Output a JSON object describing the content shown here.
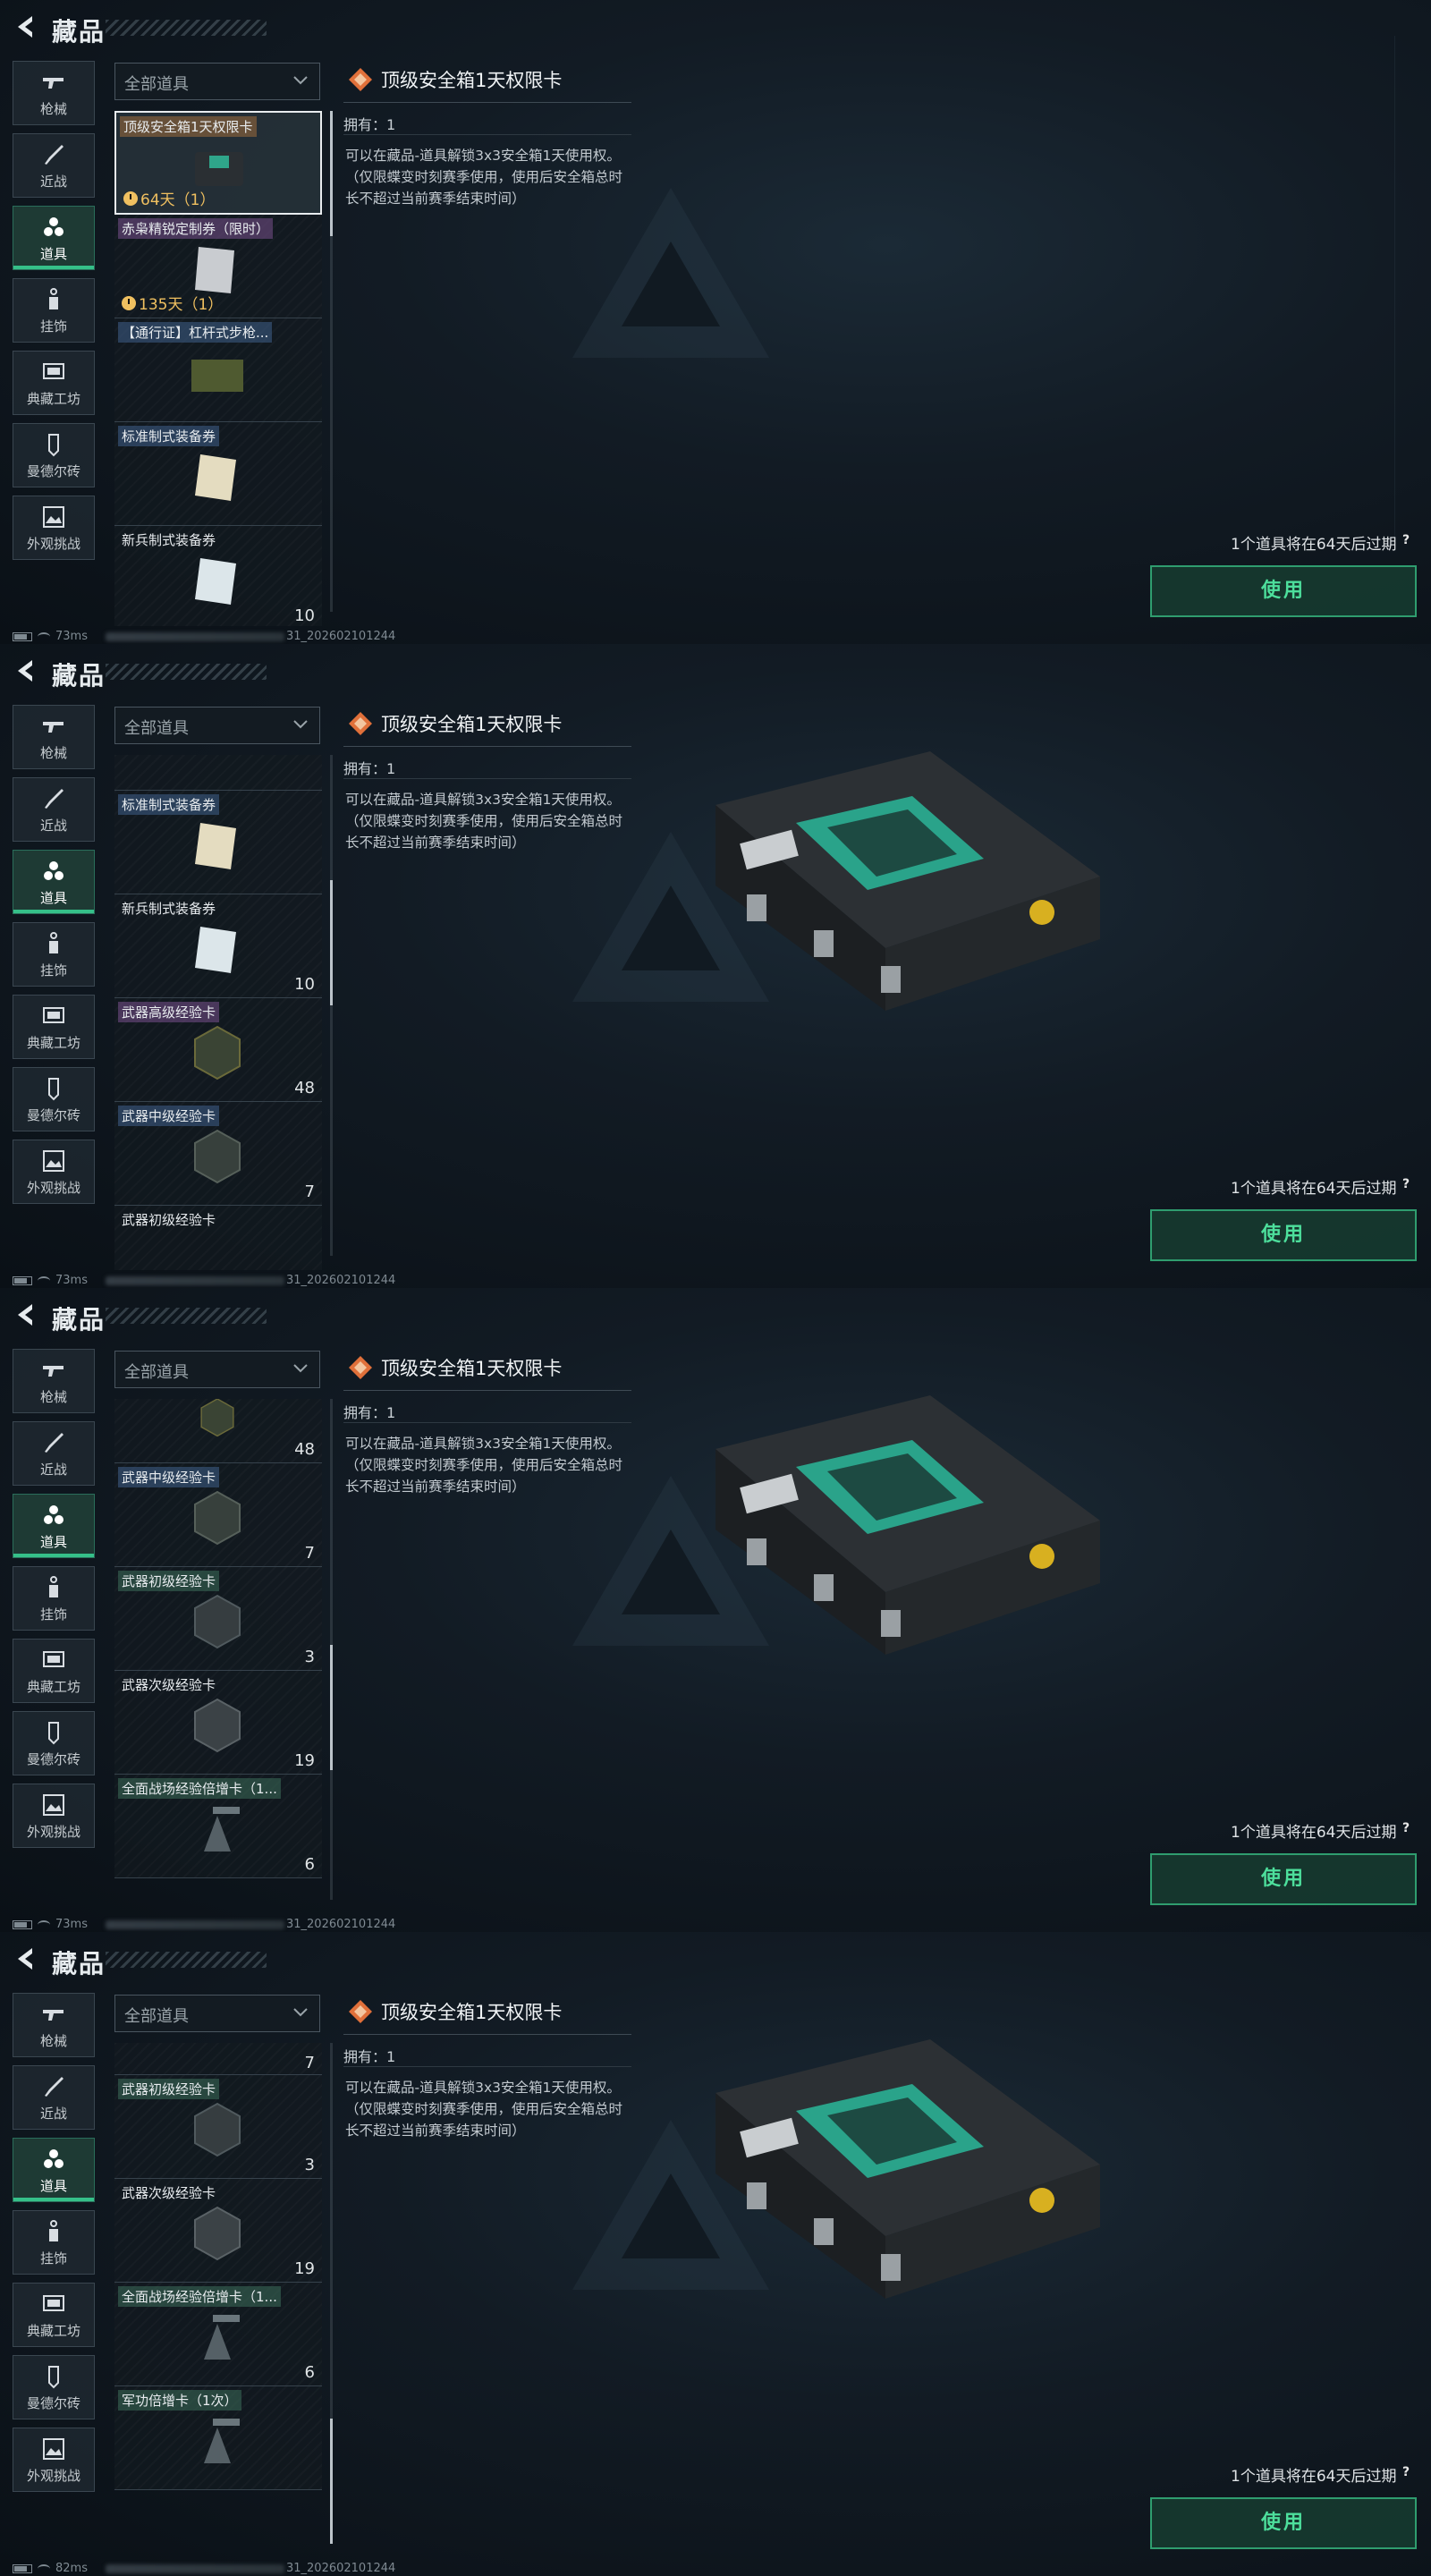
{
  "header": {
    "title": "藏品"
  },
  "sidebar": [
    {
      "label": "枪械",
      "icon": "gun-icon"
    },
    {
      "label": "近战",
      "icon": "knife-icon"
    },
    {
      "label": "道具",
      "icon": "items-icon"
    },
    {
      "label": "挂饰",
      "icon": "charm-icon"
    },
    {
      "label": "典藏工坊",
      "icon": "workshop-icon"
    },
    {
      "label": "曼德尔砖",
      "icon": "brick-icon"
    },
    {
      "label": "外观挑战",
      "icon": "challenge-icon"
    }
  ],
  "filter": {
    "label": "全部道具"
  },
  "detail": {
    "title": "顶级安全箱1天权限卡",
    "own": "拥有：1",
    "desc": "可以在藏品-道具解锁3x3安全箱1天使用权。（仅限蝶变时刻赛季使用，使用后安全箱总时长不超过当前赛季结束时间）",
    "expire": "1个道具将在64天后过期",
    "help": "?",
    "use": "使用"
  },
  "items": {
    "i1": {
      "name": "顶级安全箱1天权限卡",
      "time": "64天（1）"
    },
    "i2": {
      "name": "赤枭精锐定制券（限时）",
      "time": "135天（1）"
    },
    "i3": {
      "name": "【通行证】杠杆式步枪..."
    },
    "i4": {
      "name": "标准制式装备券"
    },
    "i5": {
      "name": "新兵制式装备券",
      "count": "10"
    },
    "i6": {
      "name": "武器高级经验卡",
      "count": "48"
    },
    "i7": {
      "name": "武器中级经验卡",
      "count": "7"
    },
    "i8": {
      "name": "武器初级经验卡",
      "count": "3"
    },
    "i9": {
      "name": "武器次级经验卡",
      "count": "19"
    },
    "i10": {
      "name": "全面战场经验倍增卡（1...",
      "count": "6"
    },
    "i11": {
      "name": "军功倍增卡（1次）"
    }
  },
  "status": [
    {
      "ping": "73ms",
      "build": "31_202602101244"
    },
    {
      "ping": "73ms",
      "build": "31_202602101244"
    },
    {
      "ping": "73ms",
      "build": "31_202602101244"
    },
    {
      "ping": "82ms",
      "build": "31_202602101244"
    }
  ],
  "colors": {
    "accent": "#35c089",
    "button_text": "#4ddf9c",
    "timer": "#f0c060"
  }
}
